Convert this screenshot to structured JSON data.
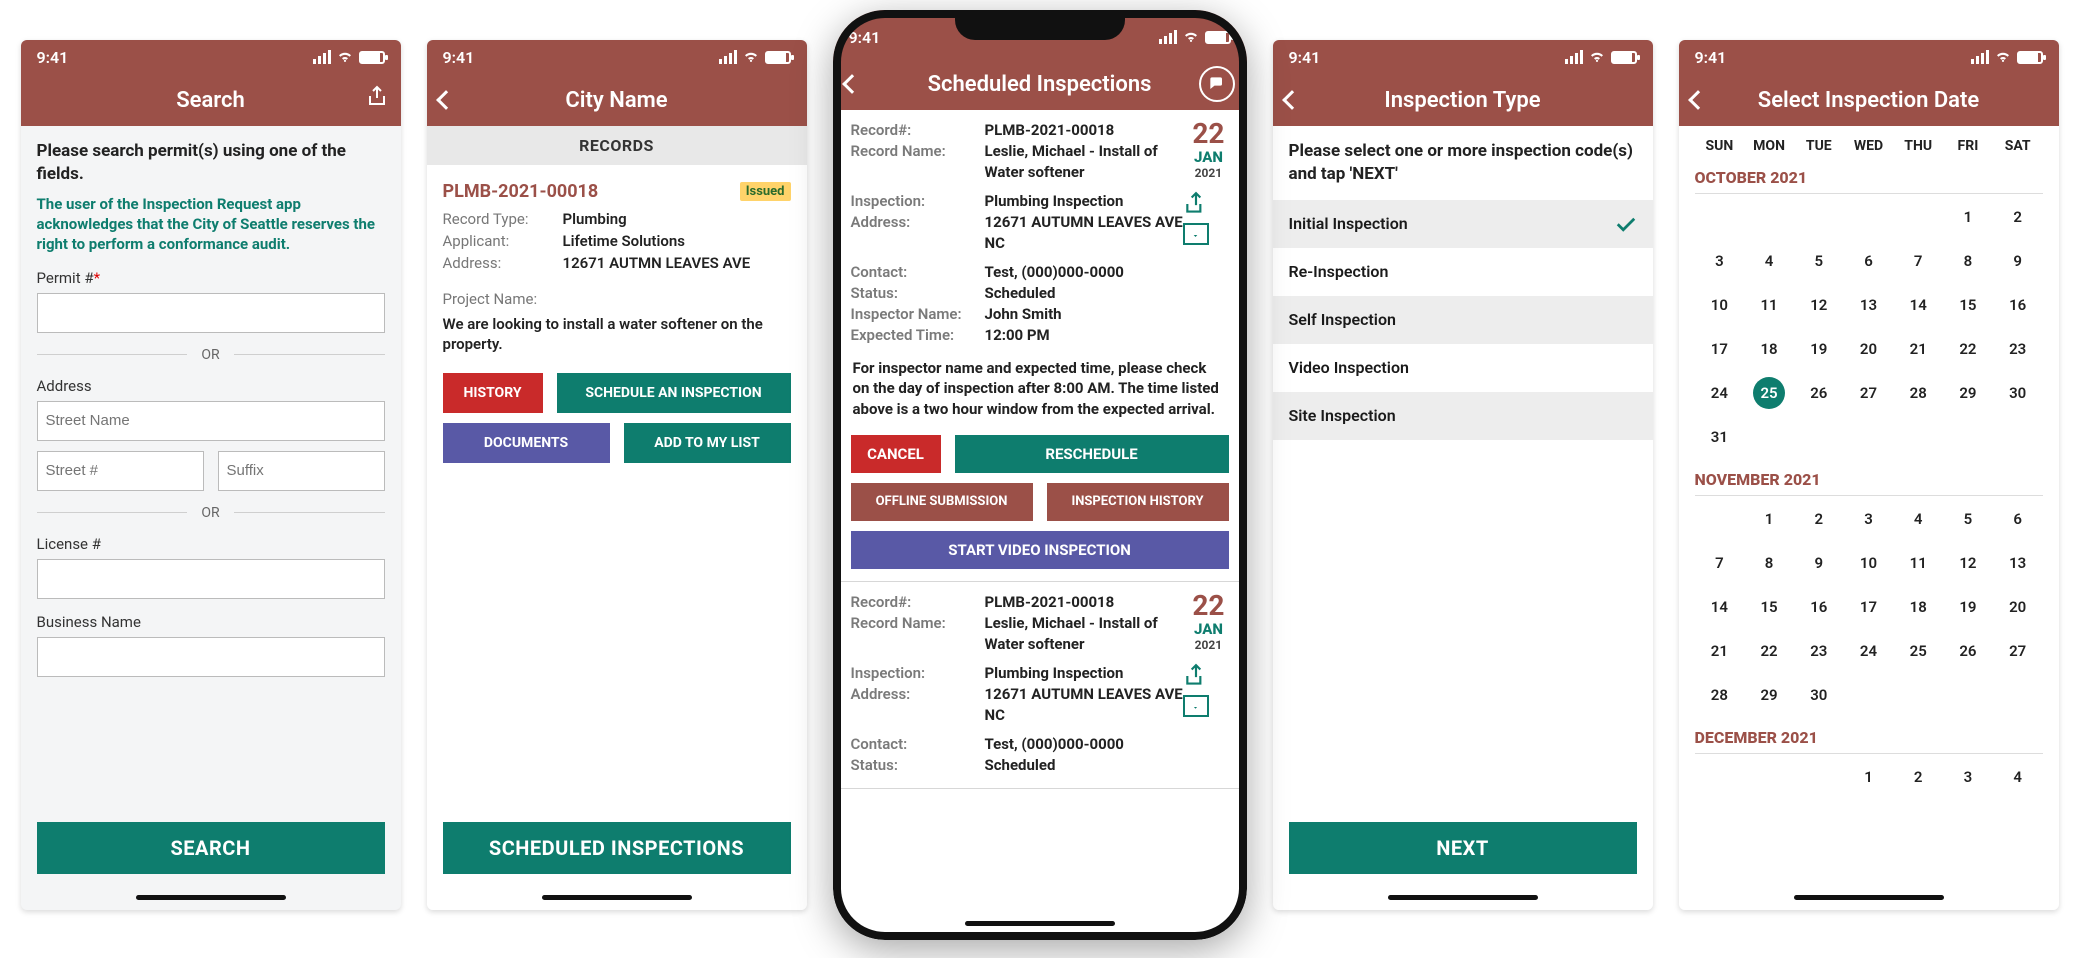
{
  "status": {
    "time": "9:41"
  },
  "screen1": {
    "title": "Search",
    "instr": "Please search permit(s) using one of the fields.",
    "ack": "The user of the Inspection Request app acknowledges that the City of Seattle reserves the right to perform a conformance audit.",
    "permit_label": "Permit #",
    "or": "OR",
    "address_label": "Address",
    "street_name_ph": "Street Name",
    "street_num_ph": "Street #",
    "suffix_ph": "Suffix",
    "license_label": "License #",
    "business_label": "Business Name",
    "search_btn": "SEARCH"
  },
  "screen2": {
    "title": "City Name",
    "subheader": "RECORDS",
    "record_id": "PLMB-2021-00018",
    "status_badge": "Issued",
    "record_type_k": "Record Type:",
    "record_type_v": "Plumbing",
    "applicant_k": "Applicant:",
    "applicant_v": "Lifetime Solutions",
    "address_k": "Address:",
    "address_v": "12671 AUTMN LEAVES AVE",
    "project_name_k": "Project Name:",
    "project_desc": "We are looking to install a water softener on the property.",
    "btn_history": "HISTORY",
    "btn_schedule": "SCHEDULE AN INSPECTION",
    "btn_documents": "DOCUMENTS",
    "btn_addlist": "ADD TO MY LIST",
    "bottom_btn": "SCHEDULED INSPECTIONS"
  },
  "screen3": {
    "title": "Scheduled Inspections",
    "date_day": "22",
    "date_mon": "JAN",
    "date_year": "2021",
    "kv": {
      "recordnum_k": "Record#:",
      "recordnum_v": "PLMB-2021-00018",
      "recordname_k": "Record Name:",
      "recordname_v": "Leslie, Michael - Install of Water softener",
      "inspection_k": "Inspection:",
      "inspection_v": "Plumbing Inspection",
      "address_k": "Address:",
      "address_v": "12671 AUTUMN LEAVES AVE NC",
      "contact_k": "Contact:",
      "contact_v": "Test, (000)000-0000",
      "status_k": "Status:",
      "status_v": "Scheduled",
      "inspector_k": "Inspector Name:",
      "inspector_v": "John Smith",
      "expected_k": "Expected Time:",
      "expected_v": "12:00 PM"
    },
    "note": "For inspector name and expected time, please check on the day of inspection after 8:00 AM. The time listed above is a two hour window from the expected arrival.",
    "btn_cancel": "CANCEL",
    "btn_reschedule": "RESCHEDULE",
    "btn_offline": "OFFLINE SUBMISSION",
    "btn_history": "INSPECTION HISTORY",
    "btn_video": "START VIDEO INSPECTION",
    "card2": {
      "status_v": "Scheduled"
    }
  },
  "screen4": {
    "title": "Inspection Type",
    "instr": "Please select one or more inspection code(s) and tap 'NEXT'",
    "items": [
      {
        "label": "Initial Inspection",
        "selected": true
      },
      {
        "label": "Re-Inspection",
        "selected": false
      },
      {
        "label": "Self Inspection",
        "selected": false
      },
      {
        "label": "Video Inspection",
        "selected": false
      },
      {
        "label": "Site Inspection",
        "selected": false
      }
    ],
    "next_btn": "NEXT"
  },
  "screen5": {
    "title": "Select Inspection Date",
    "dow": [
      "SUN",
      "MON",
      "TUE",
      "WED",
      "THU",
      "FRI",
      "SAT"
    ],
    "months": [
      {
        "name": "OCTOBER 2021",
        "lead": 5,
        "days": 31,
        "selected": 25
      },
      {
        "name": "NOVEMBER 2021",
        "lead": 1,
        "days": 30,
        "selected": null
      },
      {
        "name": "DECEMBER 2021",
        "lead": 3,
        "days": 4,
        "selected": null
      }
    ]
  }
}
